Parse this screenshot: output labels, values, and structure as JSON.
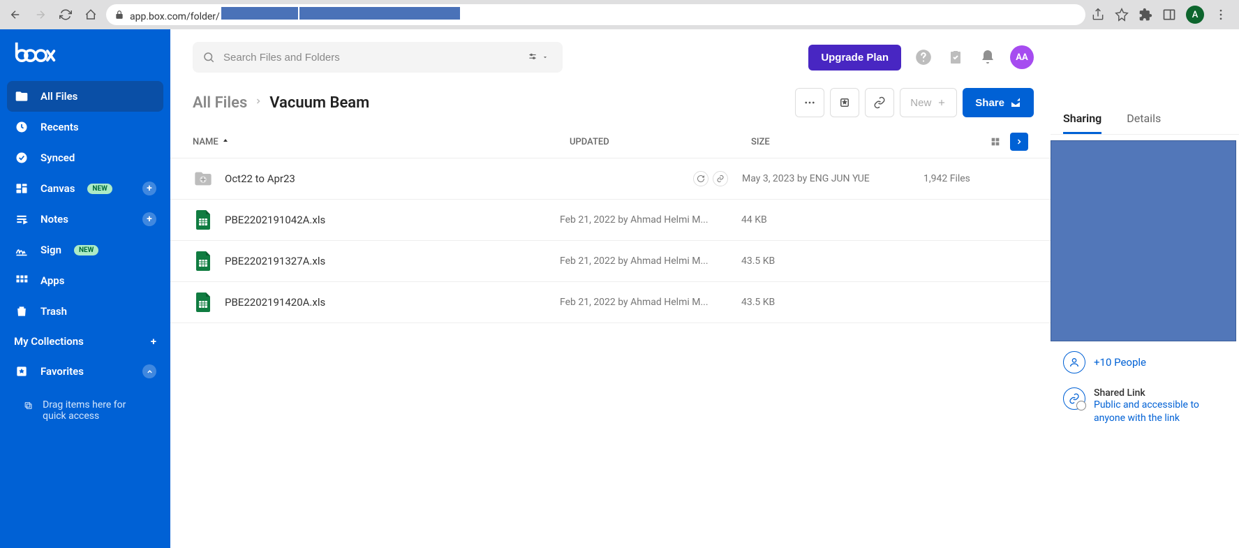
{
  "browser": {
    "url_prefix": "app.box.com/folder/",
    "profile_initial": "A"
  },
  "sidebar": {
    "items": [
      {
        "label": "All Files",
        "badge": null,
        "has_add": false
      },
      {
        "label": "Recents",
        "badge": null,
        "has_add": false
      },
      {
        "label": "Synced",
        "badge": null,
        "has_add": false
      },
      {
        "label": "Canvas",
        "badge": "NEW",
        "has_add": true
      },
      {
        "label": "Notes",
        "badge": null,
        "has_add": true
      },
      {
        "label": "Sign",
        "badge": "NEW",
        "has_add": false
      },
      {
        "label": "Apps",
        "badge": null,
        "has_add": false
      },
      {
        "label": "Trash",
        "badge": null,
        "has_add": false
      }
    ],
    "collections_label": "My Collections",
    "favorites_label": "Favorites",
    "drop_hint": "Drag items here for quick access"
  },
  "header": {
    "search_placeholder": "Search Files and Folders",
    "upgrade_label": "Upgrade Plan",
    "avatar_initials": "AA"
  },
  "breadcrumb": {
    "root": "All Files",
    "current": "Vacuum Beam"
  },
  "actions": {
    "new_label": "New",
    "share_label": "Share"
  },
  "columns": {
    "name": "NAME",
    "updated": "UPDATED",
    "size": "SIZE"
  },
  "rows": [
    {
      "type": "folder",
      "name": "Oct22 to Apr23",
      "updated": "May 3, 2023 by ENG JUN YUE",
      "size": "1,942 Files",
      "badges": true
    },
    {
      "type": "xls",
      "name": "PBE2202191042A.xls",
      "updated": "Feb 21, 2022 by Ahmad Helmi M...",
      "size": "44 KB",
      "badges": false
    },
    {
      "type": "xls",
      "name": "PBE2202191327A.xls",
      "updated": "Feb 21, 2022 by Ahmad Helmi M...",
      "size": "43.5 KB",
      "badges": false
    },
    {
      "type": "xls",
      "name": "PBE2202191420A.xls",
      "updated": "Feb 21, 2022 by Ahmad Helmi M...",
      "size": "43.5 KB",
      "badges": false
    }
  ],
  "panel": {
    "tab_sharing": "Sharing",
    "tab_details": "Details",
    "more_people": "+10 People",
    "shared_link_label": "Shared Link",
    "shared_link_desc": "Public and accessible to anyone with the link"
  }
}
